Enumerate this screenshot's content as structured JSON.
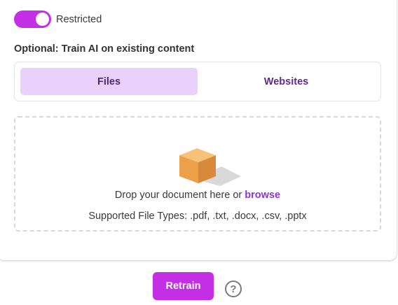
{
  "access": {
    "toggle_state": "on",
    "toggle_label": "Restricted"
  },
  "training": {
    "section_title": "Optional: Train AI on existing content",
    "tabs": [
      {
        "label": "Files",
        "active": true
      },
      {
        "label": "Websites",
        "active": false
      }
    ],
    "dropzone": {
      "icon": "box-icon",
      "prompt_prefix": "Drop your document here or ",
      "browse_label": "browse",
      "supported_types": "Supported File Types: .pdf, .txt, .docx, .csv, .pptx"
    }
  },
  "footer": {
    "retrain_label": "Retrain",
    "help_glyph": "?",
    "help_icon": "help-circle-icon"
  },
  "colors": {
    "accent": "#c42fe6",
    "active_tab_bg": "#ead1fb",
    "link": "#8a35cf"
  }
}
